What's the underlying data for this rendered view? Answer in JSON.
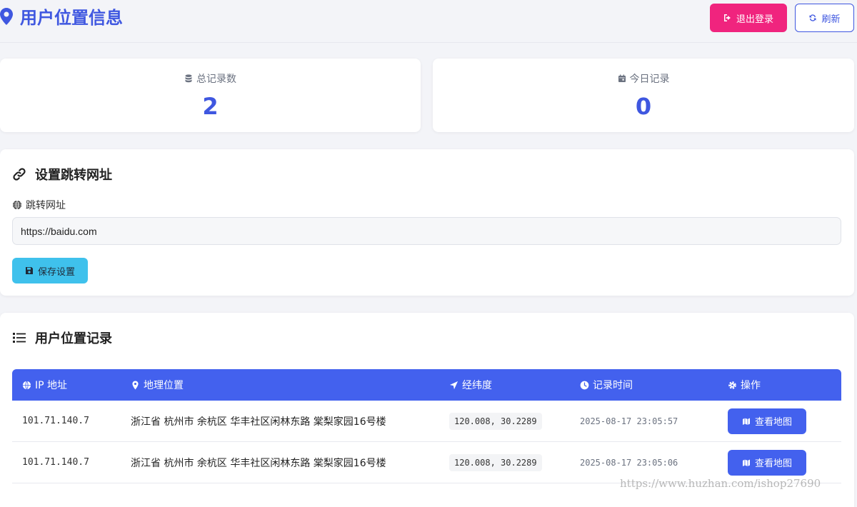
{
  "header": {
    "title": "用户位置信息",
    "logout_label": "退出登录",
    "refresh_label": "刷新"
  },
  "stats": {
    "total": {
      "label": "总记录数",
      "value": "2"
    },
    "today": {
      "label": "今日记录",
      "value": "0"
    }
  },
  "settings": {
    "title": "设置跳转网址",
    "field_label": "跳转网址",
    "url_value": "https://baidu.com",
    "save_label": "保存设置"
  },
  "records": {
    "title": "用户位置记录",
    "columns": [
      "IP 地址",
      "地理位置",
      "经纬度",
      "记录时间",
      "操作"
    ],
    "rows": [
      {
        "ip": "101.71.140.7",
        "location": "浙江省 杭州市 余杭区 华丰社区闲林东路 棠梨家园16号楼",
        "coords": "120.008, 30.2289",
        "time": "2025-08-17 23:05:57",
        "action": "查看地图"
      },
      {
        "ip": "101.71.140.7",
        "location": "浙江省 杭州市 余杭区 华丰社区闲林东路 棠梨家园16号楼",
        "coords": "120.008, 30.2289",
        "time": "2025-08-17 23:05:06",
        "action": "查看地图"
      }
    ]
  },
  "watermark": "https://www.huzhan.com/ishop27690",
  "colors": {
    "primary": "#4361ee",
    "title_blue": "#3f57e0",
    "logout_pink": "#f0247e",
    "save_cyan": "#3fc1ec",
    "background": "#f3f4f8"
  }
}
